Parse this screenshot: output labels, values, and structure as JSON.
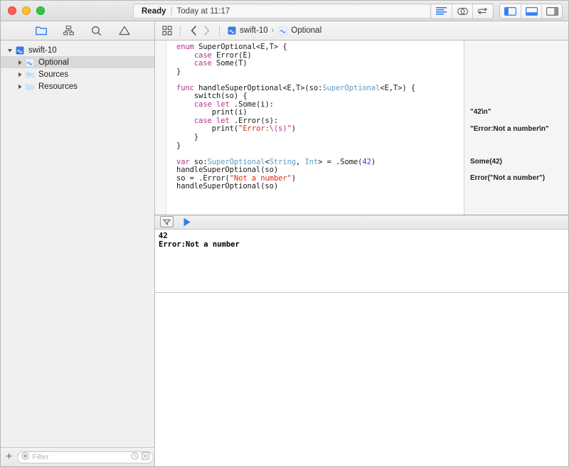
{
  "window": {
    "traffic_lights": [
      "close",
      "minimize",
      "zoom"
    ]
  },
  "titlebar": {
    "status_ready": "Ready",
    "status_separator": "|",
    "status_time": "Today at 11:17",
    "right_buttons": [
      {
        "name": "standard-editor-button",
        "icon": "lines-icon"
      },
      {
        "name": "assistant-editor-button",
        "icon": "venn-icon"
      },
      {
        "name": "version-editor-button",
        "icon": "arrows-icon"
      },
      {
        "name": "toggle-navigator-button",
        "icon": "left-panel-icon"
      },
      {
        "name": "toggle-debug-area-button",
        "icon": "bottom-panel-icon"
      },
      {
        "name": "toggle-utilities-button",
        "icon": "right-panel-icon"
      }
    ]
  },
  "navigator_tabs": [
    {
      "name": "tab-project-navigator",
      "icon": "folder-icon",
      "active": true
    },
    {
      "name": "tab-symbol-navigator",
      "icon": "hierarchy-icon",
      "active": false
    },
    {
      "name": "tab-find-navigator",
      "icon": "search-icon",
      "active": false
    },
    {
      "name": "tab-issue-navigator",
      "icon": "warning-icon",
      "active": false
    }
  ],
  "breadcrumb": {
    "grid_button": "grid-icon",
    "back": "chevron-left-icon",
    "forward": "chevron-right-icon",
    "items": [
      {
        "label": "swift-10",
        "icon": "playground-project-icon"
      },
      {
        "label": "Optional",
        "icon": "playground-file-icon"
      }
    ],
    "separator": "›"
  },
  "sidebar": {
    "tree": [
      {
        "label": "swift-10",
        "icon": "playground-project-icon",
        "depth": 0,
        "disclosure": "open",
        "selected": false
      },
      {
        "label": "Optional",
        "icon": "playground-file-icon",
        "depth": 1,
        "disclosure": "closed",
        "selected": true
      },
      {
        "label": "Sources",
        "icon": "folder-blue-icon",
        "depth": 1,
        "disclosure": "closed",
        "selected": false
      },
      {
        "label": "Resources",
        "icon": "folder-blue-icon",
        "depth": 1,
        "disclosure": "closed",
        "selected": false
      }
    ],
    "filter": {
      "placeholder": "Filter",
      "value": "",
      "add_button": "+",
      "left_icon": "filter-circle-icon",
      "recent_icon": "clock-icon",
      "clear_icon": "filter-box-icon"
    }
  },
  "editor": {
    "lines": [
      [
        {
          "t": "enum ",
          "c": "kw"
        },
        {
          "t": "SuperOptional<E,T> {",
          "c": "plain"
        }
      ],
      [
        {
          "t": "    ",
          "c": "plain"
        },
        {
          "t": "case ",
          "c": "kw"
        },
        {
          "t": "Error(E)",
          "c": "plain"
        }
      ],
      [
        {
          "t": "    ",
          "c": "plain"
        },
        {
          "t": "case ",
          "c": "kw"
        },
        {
          "t": "Some(T)",
          "c": "plain"
        }
      ],
      [
        {
          "t": "}",
          "c": "plain"
        }
      ],
      [
        {
          "t": "",
          "c": "plain"
        }
      ],
      [
        {
          "t": "func ",
          "c": "kw"
        },
        {
          "t": "handleSuperOptional<E,T>(so:",
          "c": "plain"
        },
        {
          "t": "SuperOptional",
          "c": "type"
        },
        {
          "t": "<E,T>) {",
          "c": "plain"
        }
      ],
      [
        {
          "t": "    switch(so) {",
          "c": "plain"
        }
      ],
      [
        {
          "t": "    ",
          "c": "plain"
        },
        {
          "t": "case let ",
          "c": "kw"
        },
        {
          "t": ".Some(i):",
          "c": "plain"
        }
      ],
      [
        {
          "t": "        print(i)",
          "c": "plain"
        }
      ],
      [
        {
          "t": "    ",
          "c": "plain"
        },
        {
          "t": "case let ",
          "c": "kw"
        },
        {
          "t": ".Error(s):",
          "c": "plain"
        }
      ],
      [
        {
          "t": "        print(",
          "c": "plain"
        },
        {
          "t": "\"Error:",
          "c": "str"
        },
        {
          "t": "\\(s)",
          "c": "esc"
        },
        {
          "t": "\"",
          "c": "str"
        },
        {
          "t": ")",
          "c": "plain"
        }
      ],
      [
        {
          "t": "    }",
          "c": "plain"
        }
      ],
      [
        {
          "t": "}",
          "c": "plain"
        }
      ],
      [
        {
          "t": "",
          "c": "plain"
        }
      ],
      [
        {
          "t": "var ",
          "c": "kw"
        },
        {
          "t": "so:",
          "c": "plain"
        },
        {
          "t": "SuperOptional",
          "c": "type"
        },
        {
          "t": "<",
          "c": "plain"
        },
        {
          "t": "String",
          "c": "type"
        },
        {
          "t": ", ",
          "c": "plain"
        },
        {
          "t": "Int",
          "c": "type"
        },
        {
          "t": "> = .Some(",
          "c": "plain"
        },
        {
          "t": "42",
          "c": "num"
        },
        {
          "t": ")",
          "c": "plain"
        }
      ],
      [
        {
          "t": "handleSuperOptional(so)",
          "c": "plain"
        }
      ],
      [
        {
          "t": "so = .Error(",
          "c": "plain"
        },
        {
          "t": "\"Not a number\"",
          "c": "str"
        },
        {
          "t": ")",
          "c": "plain"
        }
      ],
      [
        {
          "t": "handleSuperOptional(so)",
          "c": "plain"
        }
      ]
    ]
  },
  "results": [
    {
      "text": "\"42\\n\"",
      "line": 9
    },
    {
      "text": "\"Error:Not a number\\n\"",
      "line": 11
    },
    {
      "text": "Some(42)",
      "line": 15
    },
    {
      "text": "Error(\"Not a number\")",
      "line": 17
    }
  ],
  "console": {
    "toolbar": {
      "filter_button": "console-filter-icon",
      "play_button": "play-icon"
    },
    "output": "42\nError:Not a number"
  },
  "colors": {
    "accent_blue": "#2b7ef5",
    "keyword_magenta": "#b5338a",
    "type_blue": "#5a9cc4",
    "string_red": "#d12f1b",
    "number_blue": "#2b3eda",
    "sidebar_bg": "#f0f0f0",
    "results_bg": "#f5f5f5"
  }
}
